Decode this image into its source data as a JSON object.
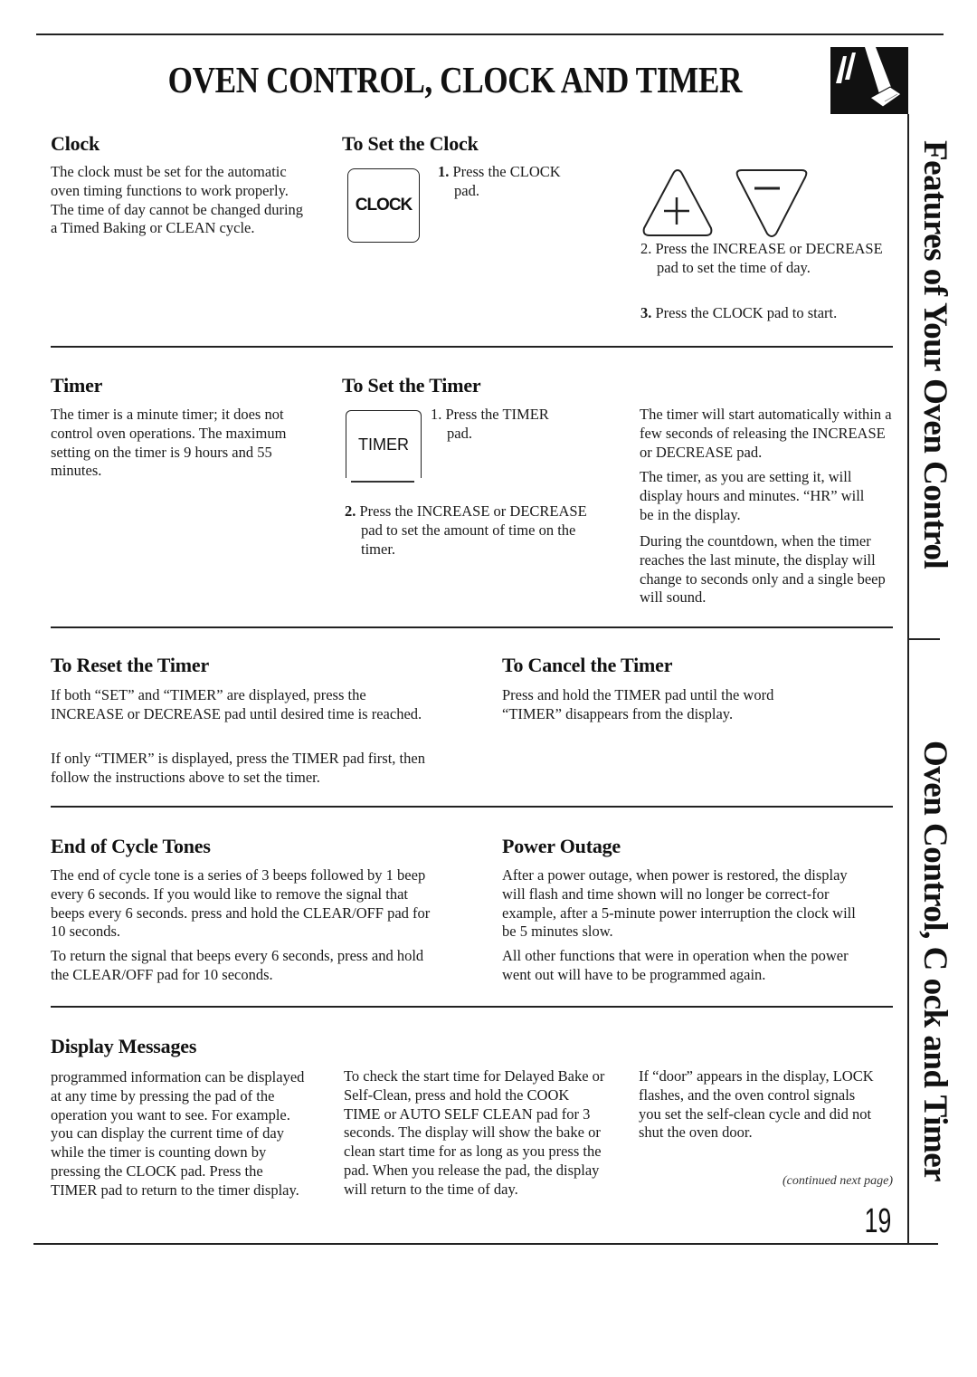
{
  "page": {
    "title": "OVEN CONTROL, CLOCK AND TIMER",
    "side_tab_top": "Features of Your Oven Control",
    "side_tab_bottom": "Oven Control, C ock and Timer",
    "continued": "(continued next page)",
    "page_number": "19",
    "corner_icon": "hand-pressing-pad-icon"
  },
  "clock": {
    "heading": "Clock",
    "body": "The clock must be set for the automatic oven timing functions to work properly. The time of day cannot be changed during a Timed Baking or CLEAN cycle."
  },
  "set_clock": {
    "heading": "To Set the Clock",
    "pad_label": "CLOCK",
    "step1_num": "1.",
    "step1_text": "Press the CLOCK pad.",
    "increase_icon": "increase-pad-icon",
    "decrease_icon": "decrease-pad-icon",
    "step2_num": "2.",
    "step2_text": "Press the INCREASE or DECREASE pad to set the time of day.",
    "step3_num": "3.",
    "step3_text": "Press the CLOCK pad to start."
  },
  "timer": {
    "heading": "Timer",
    "body": "The timer is a minute timer; it does not control oven operations. The maximum setting on the timer is 9 hours and 55 minutes."
  },
  "set_timer": {
    "heading": "To Set the Timer",
    "pad_label": "TIMER",
    "step1_num": "1.",
    "step1_text": "Press the TIMER pad.",
    "step2_num": "2.",
    "step2_text": "Press the INCREASE or DECREASE pad to set the amount of time on the timer.",
    "note1": "The timer will start automatically within a few seconds of releasing the INCREASE or DECREASE pad.",
    "note2": "The timer, as you are setting it, will display hours and minutes. “HR” will be in the display.",
    "note3": "During the countdown, when the timer reaches the last minute, the display will change to seconds only and a single beep will sound."
  },
  "reset_timer": {
    "heading": "To Reset the Timer",
    "para1": "If both “SET” and “TIMER” are displayed, press the INCREASE or DECREASE pad until desired time is reached.",
    "para2": "If only “TIMER” is displayed, press the TIMER pad first, then follow the instructions above to set the timer."
  },
  "cancel_timer": {
    "heading": "To Cancel the Timer",
    "body": "Press and hold the TIMER pad until the word “TIMER” disappears from the display."
  },
  "end_tones": {
    "heading": "End of Cycle Tones",
    "para1": "The end of cycle tone is a series of 3 beeps followed by 1 beep every 6 seconds. If you would like to remove the signal that beeps every 6 seconds. press and hold the CLEAR/OFF pad for 10 seconds.",
    "para2": "To return the signal that beeps every 6 seconds, press and hold the CLEAR/OFF pad for 10 seconds."
  },
  "power_outage": {
    "heading": "Power Outage",
    "para1": "After a power outage, when power is restored, the display will flash and time shown will no longer be correct-for example, after a 5-minute power interruption the clock will be 5 minutes slow.",
    "para2": "All other functions that were in operation when the power went out will have to be programmed again."
  },
  "display_messages": {
    "heading": "Display Messages",
    "col1": "programmed information can be displayed at any time by pressing the pad of the operation you want to see. For example. you can display the current time of day while the timer is counting down by pressing the CLOCK pad. Press the TIMER pad to return to the timer display.",
    "col2": "To check the start time for Delayed Bake or Self-Clean, press and hold the COOK TIME or AUTO SELF CLEAN pad for 3 seconds. The display will show the bake or clean start time for as long as you press the pad. When you release the pad, the display will return to the time of day.",
    "col3": "If “door” appears in the display, LOCK flashes, and the oven control signals you set the self-clean cycle and did not shut the oven door."
  }
}
